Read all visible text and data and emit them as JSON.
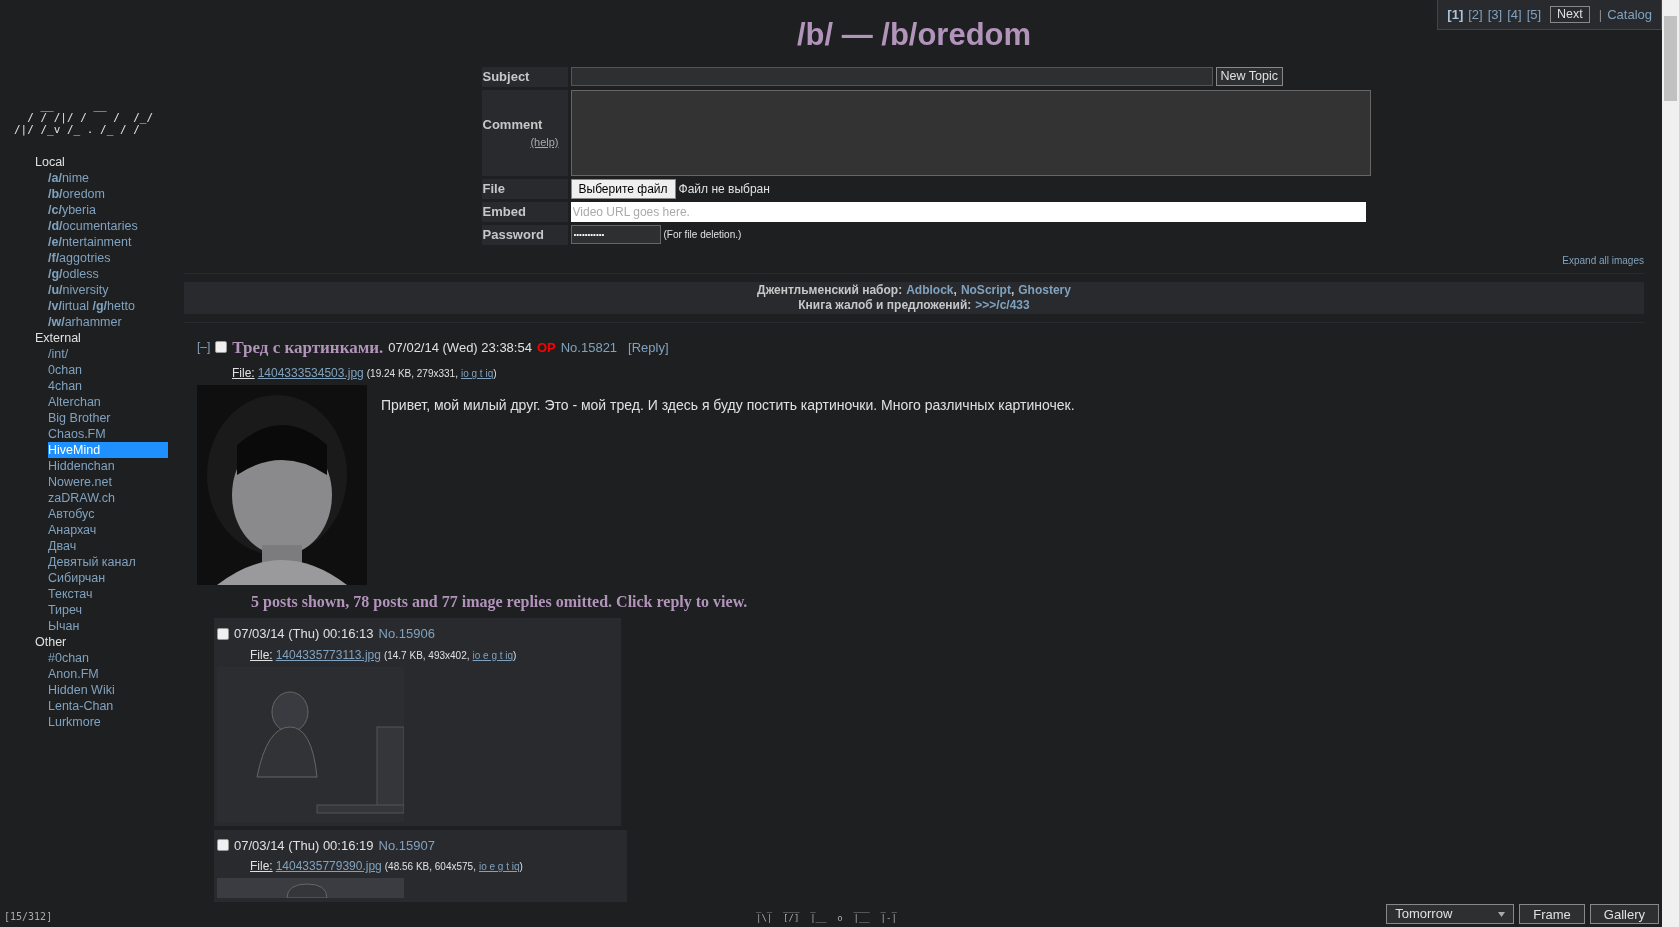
{
  "logo_ascii": [
    "    __      __  ",
    "  / / /|/ /    /  /_/",
    "/|/ /_v /_ . /_ / /"
  ],
  "sidebar": {
    "sections": [
      {
        "title": "Local",
        "items": [
          {
            "label": "**/a/**nime",
            "selected": false
          },
          {
            "label": "**/b/**oredom",
            "selected": false
          },
          {
            "label": "**/c/**yberia",
            "selected": false
          },
          {
            "label": "**/d/**ocumentaries",
            "selected": false
          },
          {
            "label": "**/e/**ntertainment",
            "selected": false
          },
          {
            "label": "**/f/**aggotries",
            "selected": false
          },
          {
            "label": "**/g/**odless",
            "selected": false
          },
          {
            "label": "**/u/**niversity",
            "selected": false
          },
          {
            "label": "**/v/**irtual **/g/**hetto",
            "selected": false
          },
          {
            "label": "**/w/**arhammer",
            "selected": false
          }
        ]
      },
      {
        "title": "External",
        "items": [
          {
            "label": "/int/",
            "selected": false
          },
          {
            "label": "0chan",
            "selected": false
          },
          {
            "label": "4chan",
            "selected": false
          },
          {
            "label": "Alterchan",
            "selected": false
          },
          {
            "label": "Big Brother",
            "selected": false
          },
          {
            "label": "Chaos.FM",
            "selected": false
          },
          {
            "label": "HiveMind",
            "selected": true
          },
          {
            "label": "Hiddenchan",
            "selected": false
          },
          {
            "label": "Nowere.net",
            "selected": false
          },
          {
            "label": "zaDRAW.ch",
            "selected": false
          },
          {
            "label": "Автобус",
            "selected": false
          },
          {
            "label": "Анархач",
            "selected": false
          },
          {
            "label": "Двач",
            "selected": false
          },
          {
            "label": "Девятый канал",
            "selected": false
          },
          {
            "label": "Сибирчан",
            "selected": false
          },
          {
            "label": "Текстач",
            "selected": false
          },
          {
            "label": "Тиреч",
            "selected": false
          },
          {
            "label": "Ычан",
            "selected": false
          }
        ]
      },
      {
        "title": "Other",
        "items": [
          {
            "label": "#0chan",
            "selected": false
          },
          {
            "label": "Anon.FM",
            "selected": false
          },
          {
            "label": "Hidden Wiki",
            "selected": false
          },
          {
            "label": "Lenta-Chan",
            "selected": false
          },
          {
            "label": "Lurkmore",
            "selected": false
          }
        ]
      }
    ]
  },
  "pagination": {
    "pages": [
      {
        "label": "[1]",
        "selected": true
      },
      {
        "label": "[2]",
        "selected": false
      },
      {
        "label": "[3]",
        "selected": false
      },
      {
        "label": "[4]",
        "selected": false
      },
      {
        "label": "[5]",
        "selected": false
      }
    ],
    "next": "Next",
    "separator": "|",
    "catalog": "Catalog"
  },
  "title": "/b/ — /b/oredom",
  "form": {
    "subject_label": "Subject",
    "submit": "New Topic",
    "comment_label": "Comment",
    "help": "(help)",
    "file_label": "File",
    "file_button": "Выберите файл",
    "file_status": "Файл не выбран",
    "embed_label": "Embed",
    "embed_placeholder": "Video URL goes here.",
    "password_label": "Password",
    "password_value": "•••••••••••",
    "password_note": "(For file deletion.)"
  },
  "expand_all": "Expand all images",
  "banner": [
    {
      "label": "Джентльменский набор:",
      "links": [
        "Adblock",
        "NoScript",
        "Ghostery"
      ],
      "separator": ","
    },
    {
      "label": "Книга жалоб и предложений:",
      "links": [
        ">>>/c/433"
      ]
    }
  ],
  "thread": {
    "collapse": "[–]",
    "checked": false,
    "subject": "Тред с картинками.",
    "datetime": "07/02/14 (Wed) 23:38:54",
    "op_badge": "OP",
    "number": "No.15821",
    "reply": "[Reply]",
    "file": {
      "label": "File:",
      "name": "1404333534503.jpg",
      "info": "(19.24 KB, 279x331,",
      "search": "io g t iq",
      "close": ")"
    },
    "comment": "Привет, мой милый друг. Это - мой тред. И здесь я буду постить картиночки. Много различных картиночек.",
    "omitted": "5 posts shown, 78 posts and 77 image replies omitted. Click reply to view.",
    "replies": [
      {
        "checked": false,
        "datetime": "07/03/14 (Thu) 00:16:13",
        "number": "No.15906",
        "file": {
          "label": "File:",
          "name": "1404335773113.jpg",
          "info": "(14.7 KB, 493x402,",
          "search": "io e g t iq",
          "close": ")"
        }
      },
      {
        "checked": false,
        "datetime": "07/03/14 (Thu) 00:16:19",
        "number": "No.15907",
        "file": {
          "label": "File:",
          "name": "1404335779390.jpg",
          "info": "(48.56 KB, 604x575,",
          "search": "io e g t iq",
          "close": ")"
        }
      }
    ]
  },
  "footer": {
    "counter": "[15/312]",
    "ascii": [
      "_ _  ___  _       ___  _ _",
      "|\\|  [/]  |__  o  |__  |-|"
    ],
    "style_select": "Tomorrow",
    "buttons": [
      "Frame",
      "Gallery"
    ]
  }
}
